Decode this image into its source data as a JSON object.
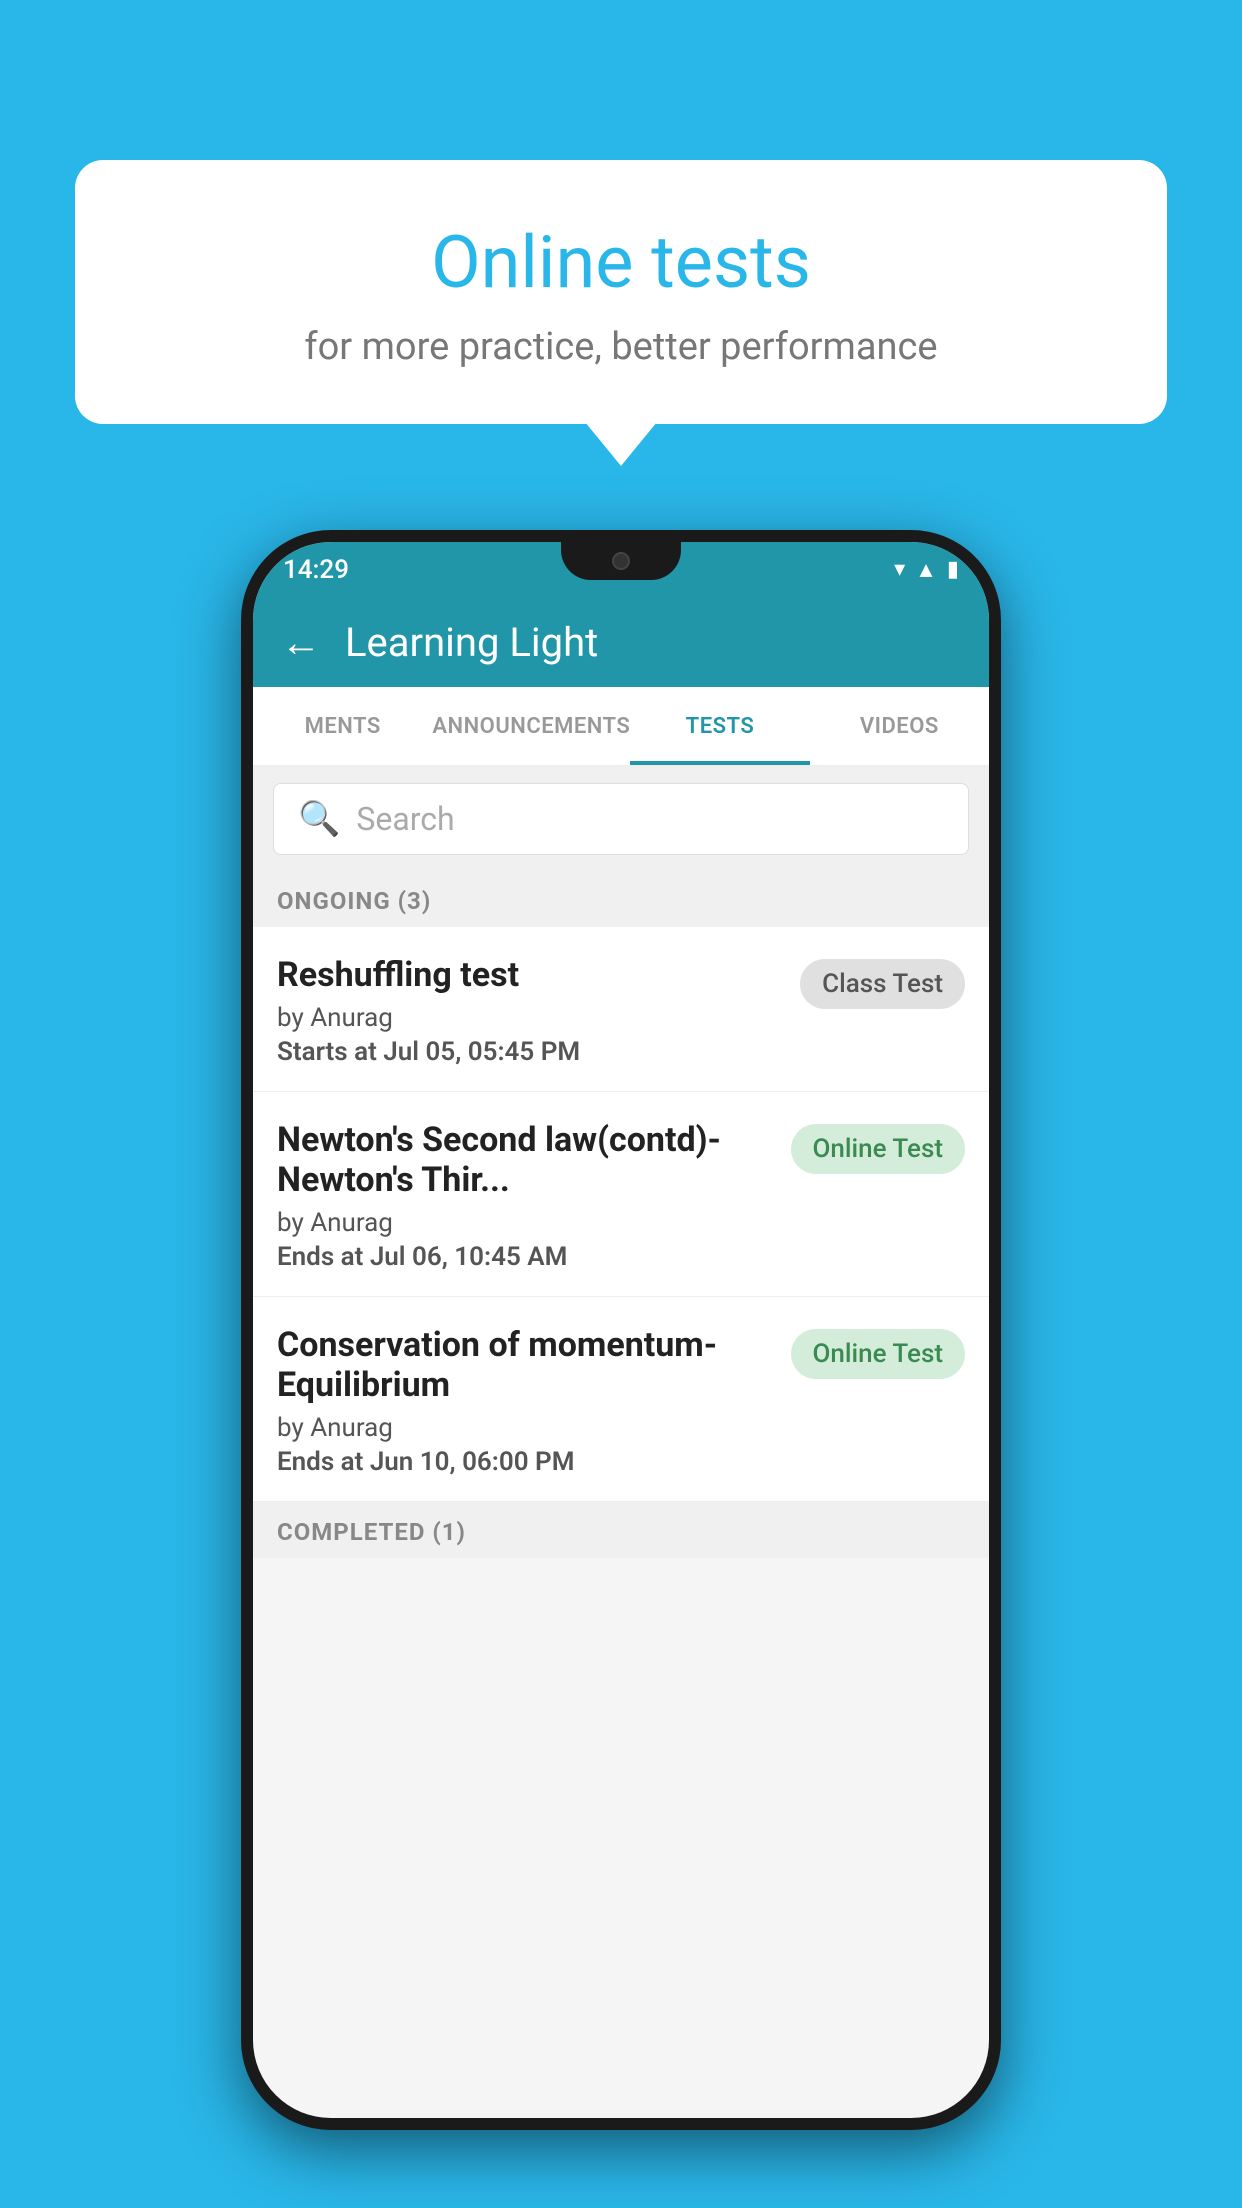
{
  "background_color": "#29b6e8",
  "bubble": {
    "title": "Online tests",
    "subtitle": "for more practice, better performance"
  },
  "phone": {
    "status_bar": {
      "time": "14:29",
      "icons": [
        "wifi",
        "signal",
        "battery"
      ]
    },
    "header": {
      "back_label": "←",
      "title": "Learning Light"
    },
    "tabs": [
      {
        "label": "MENTS",
        "active": false
      },
      {
        "label": "ANNOUNCEMENTS",
        "active": false
      },
      {
        "label": "TESTS",
        "active": true
      },
      {
        "label": "VIDEOS",
        "active": false
      }
    ],
    "search": {
      "placeholder": "Search"
    },
    "ongoing_section": {
      "label": "ONGOING (3)",
      "items": [
        {
          "name": "Reshuffling test",
          "by": "by Anurag",
          "date_label": "Starts at",
          "date_value": "Jul 05, 05:45 PM",
          "badge": "Class Test",
          "badge_type": "class"
        },
        {
          "name": "Newton's Second law(contd)-Newton's Thir...",
          "by": "by Anurag",
          "date_label": "Ends at",
          "date_value": "Jul 06, 10:45 AM",
          "badge": "Online Test",
          "badge_type": "online"
        },
        {
          "name": "Conservation of momentum-Equilibrium",
          "by": "by Anurag",
          "date_label": "Ends at",
          "date_value": "Jun 10, 06:00 PM",
          "badge": "Online Test",
          "badge_type": "online"
        }
      ]
    },
    "completed_section": {
      "label": "COMPLETED (1)"
    }
  }
}
